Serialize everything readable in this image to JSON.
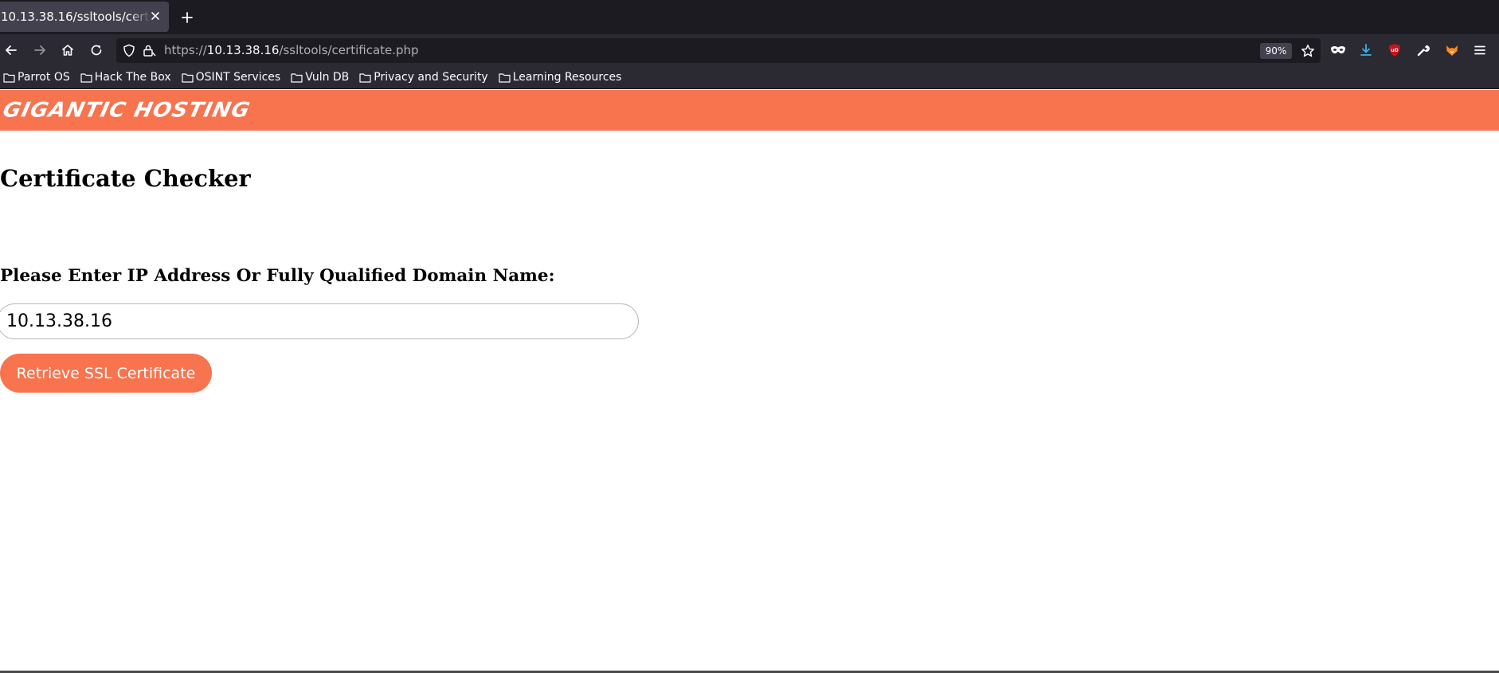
{
  "browser": {
    "tab": {
      "title": "10.13.38.16/ssltools/certificate.php"
    },
    "url": {
      "scheme_prefix": "https://",
      "host": "10.13.38.16",
      "path": "/ssltools/certificate.php"
    },
    "zoom_label": "90%",
    "bookmarks": [
      {
        "label": "Parrot OS"
      },
      {
        "label": "Hack The Box"
      },
      {
        "label": "OSINT Services"
      },
      {
        "label": "Vuln DB"
      },
      {
        "label": "Privacy and Security"
      },
      {
        "label": "Learning Resources"
      }
    ],
    "colors": {
      "tabstrip_bg": "#1c1b22",
      "toolbar_bg": "#2b2a33",
      "active_tab_bg": "#42414d",
      "download_icon": "#33b5e5",
      "ublock_icon": "#c4161c",
      "fox_icon": "#ff8a1f"
    },
    "icons": {
      "back": "arrow-left-icon",
      "forward": "arrow-right-icon",
      "home": "home-icon",
      "reload": "reload-icon",
      "tracking": "shield-icon",
      "site_info": "lock-icon",
      "bookmark": "star-icon",
      "private": "mask-icon",
      "downloads": "download-icon",
      "ublock": "ublock-icon",
      "devtools": "wrench-icon",
      "fox": "foxyproxy-icon",
      "menu": "hamburger-menu-icon",
      "folder": "folder-icon",
      "close": "close-icon",
      "new_tab": "plus-icon"
    }
  },
  "page": {
    "brand": "GIGANTIC HOSTING",
    "title": "Certificate Checker",
    "field_label": "Please Enter IP Address Or Fully Qualified Domain Name:",
    "input_value": "10.13.38.16",
    "submit_label": "Retrieve SSL Certificate",
    "accent_color": "#f7744f"
  }
}
